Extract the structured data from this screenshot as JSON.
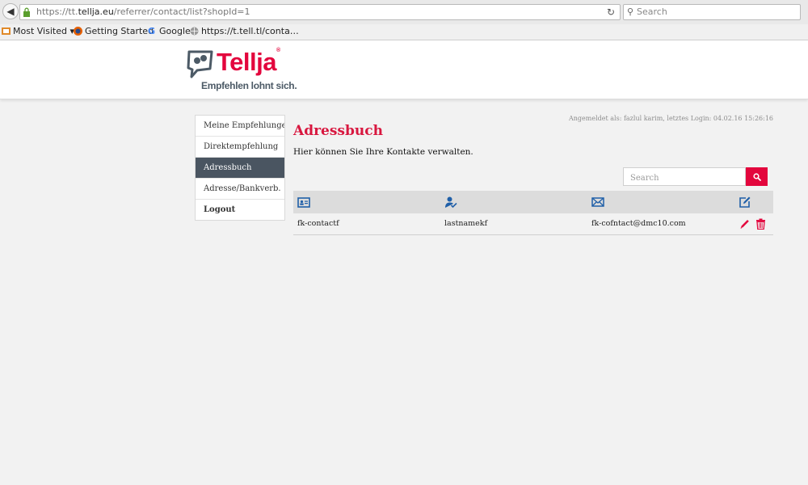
{
  "browser": {
    "url_prefix": "https://tt.",
    "url_domain": "tellja.eu",
    "url_path": "/referrer/contact/list?shopId=1",
    "search_placeholder": "Search",
    "bookmarks": [
      {
        "label": "Most Visited ▾",
        "icon": "most-visited-icon"
      },
      {
        "label": "Getting Started",
        "icon": "firefox-icon"
      },
      {
        "label": "Google",
        "icon": "google-icon"
      },
      {
        "label": "https://t.tell.tl/conta…",
        "icon": "globe-icon"
      }
    ]
  },
  "header": {
    "logo_text": "Tellja",
    "logo_reg": "®",
    "tagline": "Empfehlen lohnt sich."
  },
  "nav": {
    "items": [
      {
        "label": "Meine Empfehlungen"
      },
      {
        "label": "Direktempfehlung"
      },
      {
        "label": "Adressbuch"
      },
      {
        "label": "Adresse/Bankverb."
      },
      {
        "label": "Logout"
      }
    ]
  },
  "main": {
    "login_info": "Angemeldet als: fazlul karim, letztes Login: 04.02.16 15:26:16",
    "title": "Adressbuch",
    "subtitle": "Hier können Sie Ihre Kontakte verwalten.",
    "search_placeholder": "Search",
    "columns": [
      {
        "icon": "id-card-icon"
      },
      {
        "icon": "user-check-icon"
      },
      {
        "icon": "envelope-icon"
      },
      {
        "icon": "edit-icon"
      }
    ],
    "rows": [
      {
        "first_name": "fk-contactf",
        "last_name": "lastnamekf",
        "email": "fk-cofntact@dmc10.com"
      }
    ]
  },
  "colors": {
    "brand": "#e3063d",
    "title": "#d8173f",
    "nav_active": "#4a5561",
    "icon_blue": "#1f5fa8"
  }
}
